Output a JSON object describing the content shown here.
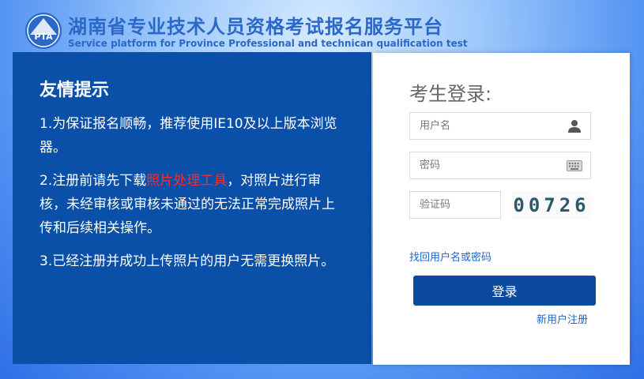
{
  "header": {
    "title_cn": "湖南省专业技术人员资格考试报名服务平台",
    "title_en": "Service platform for Province Professional and technican qualification test",
    "logo_text": "PTA"
  },
  "notice": {
    "title": "友情提示",
    "item1": "1.为保证报名顺畅，推荐使用IE10及以上版本浏览器。",
    "item2_before": "2.注册前请先下载",
    "item2_link": "照片处理工具",
    "item2_after": "，对照片进行审核，未经审核或审核未通过的无法正常完成照片上传和后续相关操作。",
    "item3": "3.已经注册并成功上传照片的用户无需更换照片。"
  },
  "login": {
    "title": "考生登录:",
    "username_placeholder": "用户名",
    "password_placeholder": "密码",
    "captcha_placeholder": "验证码",
    "captcha_code": "00726",
    "forgot_link": "找回用户名或密码",
    "login_button": "登录",
    "register_link": "新用户注册"
  },
  "colors": {
    "brand_blue": "#0a4fa8",
    "link_blue": "#1f66c9",
    "highlight_red": "#ff2a2a",
    "title_blue": "#2b68c8"
  },
  "icons": {
    "username": "user-icon",
    "password": "keyboard-icon",
    "logo": "pta-logo-icon"
  }
}
